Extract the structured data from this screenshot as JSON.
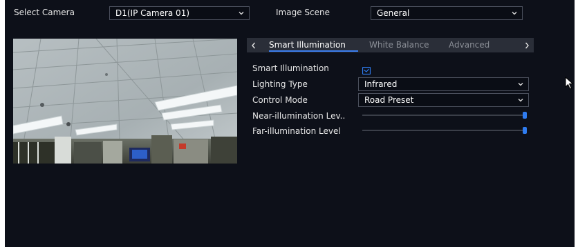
{
  "top": {
    "camera_label": "Select Camera",
    "camera_value": "D1(IP Camera 01)",
    "scene_label": "Image Scene",
    "scene_value": "General"
  },
  "tabs": {
    "prev_icon": "chevron-left-icon",
    "next_icon": "chevron-right-icon",
    "items": [
      {
        "label": "Smart Illumination",
        "active": true
      },
      {
        "label": "White Balance",
        "active": false
      },
      {
        "label": "Advanced",
        "active": false
      }
    ]
  },
  "form": {
    "smart_illumination": {
      "label": "Smart Illumination",
      "checked": true
    },
    "lighting_type": {
      "label": "Lighting Type",
      "value": "Infrared"
    },
    "control_mode": {
      "label": "Control Mode",
      "value": "Road Preset"
    },
    "near_level": {
      "label": "Near-illumination Lev..",
      "value_fraction": 1.0
    },
    "far_level": {
      "label": "Far-illumination Level",
      "value_fraction": 1.0
    }
  },
  "colors": {
    "background": "#0d1019",
    "accent": "#2f7cf0",
    "tab_bar": "#2a2e38",
    "inactive_text": "#8a8e96"
  }
}
